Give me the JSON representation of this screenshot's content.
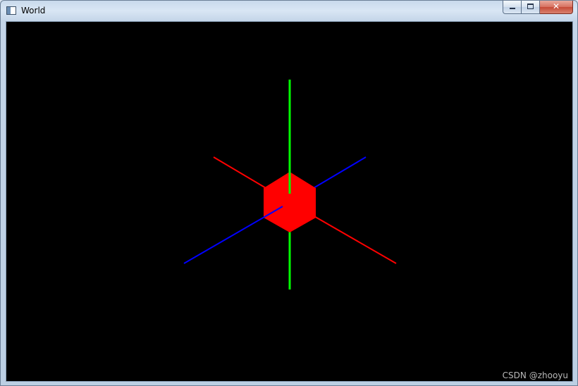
{
  "window": {
    "title": "World",
    "app_icon": "window-app-icon",
    "caption_buttons": {
      "minimize_icon": "minimize-icon",
      "maximize_icon": "maximize-icon",
      "close_icon": "close-icon",
      "close_glyph": "✕"
    }
  },
  "scene": {
    "background_color": "#000000",
    "cube_color": "#ff0000",
    "axes": [
      {
        "name": "x-axis",
        "color": "#ff0000"
      },
      {
        "name": "y-axis",
        "color": "#00ff00"
      },
      {
        "name": "z-axis",
        "color": "#0000ff"
      }
    ]
  },
  "watermark": "CSDN @zhooyu"
}
